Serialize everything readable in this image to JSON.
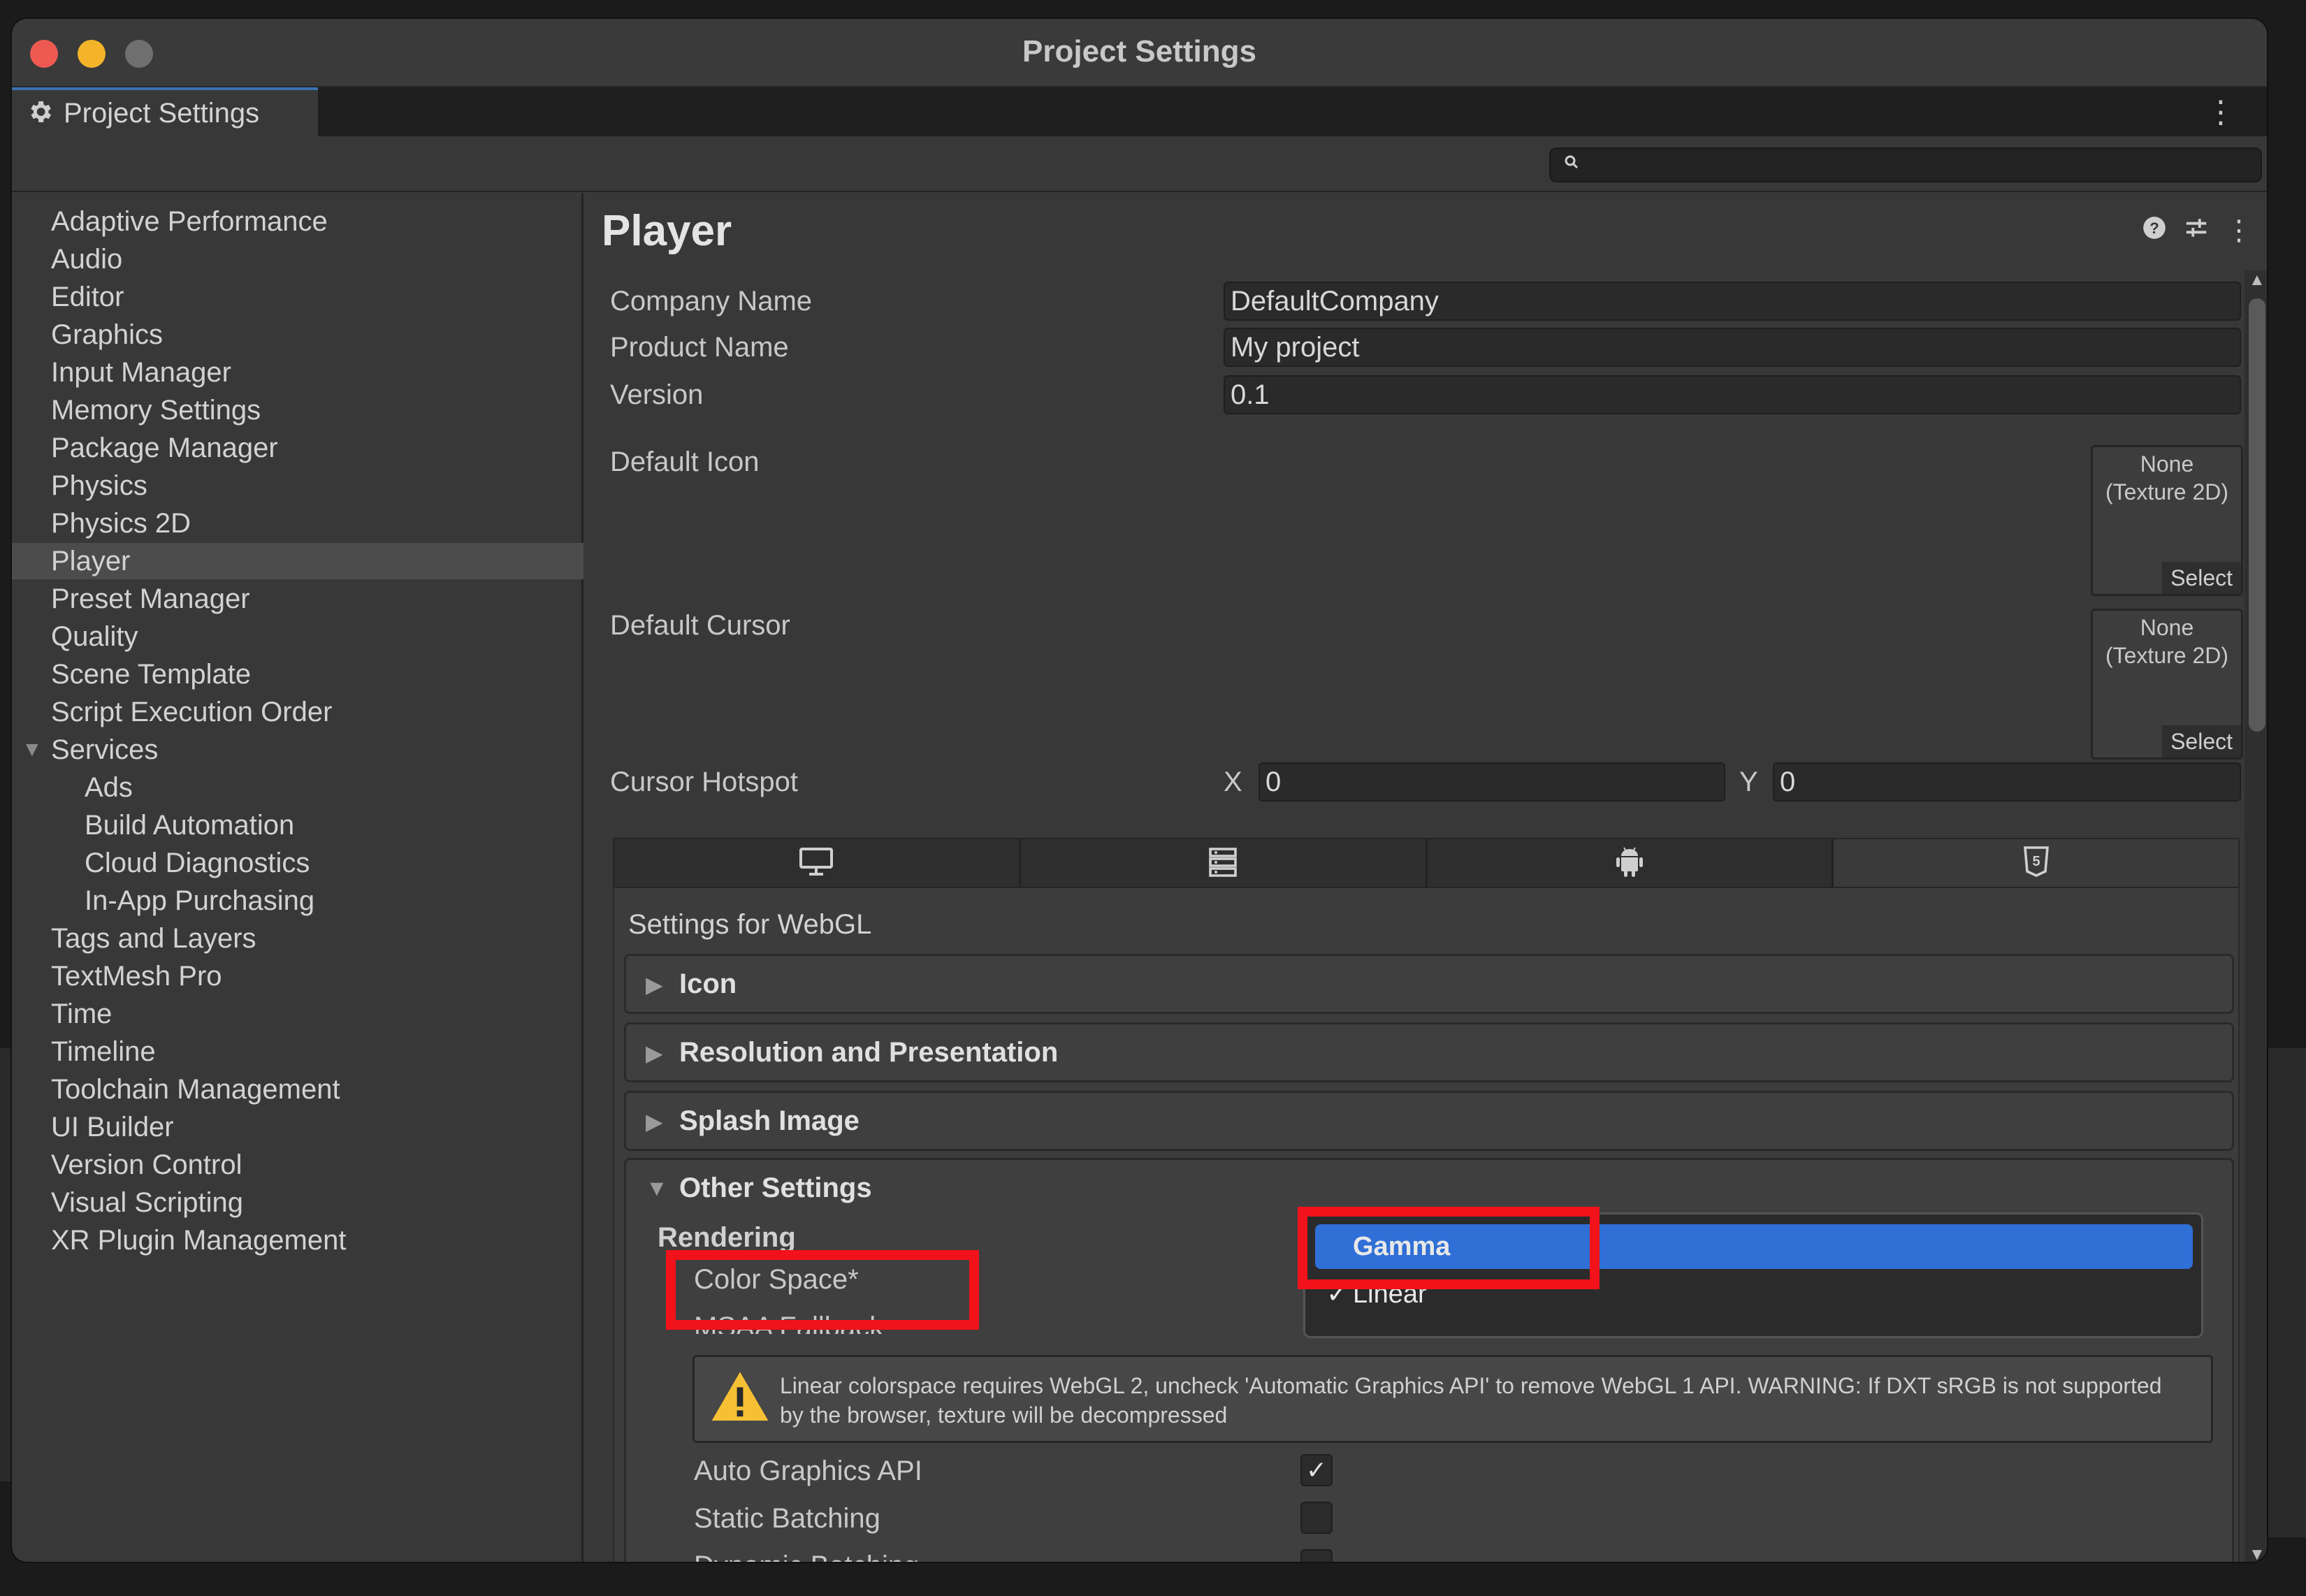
{
  "window": {
    "title": "Project Settings"
  },
  "tab": {
    "label": "Project Settings"
  },
  "search": {
    "placeholder": ""
  },
  "sidebar": {
    "items": [
      {
        "label": "Adaptive Performance"
      },
      {
        "label": "Audio"
      },
      {
        "label": "Editor"
      },
      {
        "label": "Graphics"
      },
      {
        "label": "Input Manager"
      },
      {
        "label": "Memory Settings"
      },
      {
        "label": "Package Manager"
      },
      {
        "label": "Physics"
      },
      {
        "label": "Physics 2D"
      },
      {
        "label": "Player",
        "selected": true
      },
      {
        "label": "Preset Manager"
      },
      {
        "label": "Quality"
      },
      {
        "label": "Scene Template"
      },
      {
        "label": "Script Execution Order"
      },
      {
        "label": "Services",
        "expanded": true
      },
      {
        "label": "Ads",
        "child": true
      },
      {
        "label": "Build Automation",
        "child": true
      },
      {
        "label": "Cloud Diagnostics",
        "child": true
      },
      {
        "label": "In-App Purchasing",
        "child": true
      },
      {
        "label": "Tags and Layers"
      },
      {
        "label": "TextMesh Pro"
      },
      {
        "label": "Time"
      },
      {
        "label": "Timeline"
      },
      {
        "label": "Toolchain Management"
      },
      {
        "label": "UI Builder"
      },
      {
        "label": "Version Control"
      },
      {
        "label": "Visual Scripting"
      },
      {
        "label": "XR Plugin Management"
      }
    ]
  },
  "player": {
    "title": "Player",
    "company_name_label": "Company Name",
    "company_name": "DefaultCompany",
    "product_name_label": "Product Name",
    "product_name": "My project",
    "version_label": "Version",
    "version": "0.1",
    "default_icon_label": "Default Icon",
    "default_cursor_label": "Default Cursor",
    "texture_none": "None",
    "texture_type": "(Texture 2D)",
    "select_label": "Select",
    "cursor_hotspot_label": "Cursor Hotspot",
    "hotspot_x_label": "X",
    "hotspot_x": "0",
    "hotspot_y_label": "Y",
    "hotspot_y": "0"
  },
  "platform_tabs": [
    "desktop-icon",
    "server-icon",
    "android-icon",
    "html5-icon"
  ],
  "settings_for": "Settings for WebGL",
  "foldouts": [
    {
      "label": "Icon"
    },
    {
      "label": "Resolution and Presentation"
    },
    {
      "label": "Splash Image"
    },
    {
      "label": "Other Settings"
    }
  ],
  "other_settings": {
    "rendering_label": "Rendering",
    "color_space_label": "Color Space*",
    "msaa_label": "MSAA Fallback",
    "warning_text": "Linear colorspace requires WebGL 2, uncheck 'Automatic Graphics API' to remove WebGL 1 API. WARNING: If DXT sRGB is not supported by the browser, texture will be decompressed",
    "auto_graphics_api_label": "Auto Graphics API",
    "auto_graphics_api_checked": true,
    "static_batching_label": "Static Batching",
    "static_batching_checked": false,
    "dynamic_batching_label": "Dynamic Batching",
    "dynamic_batching_checked": false
  },
  "color_space_dropdown": {
    "options": [
      {
        "label": "Gamma",
        "highlighted": true,
        "checked": false
      },
      {
        "label": "Linear",
        "highlighted": false,
        "checked": true
      }
    ]
  },
  "colors": {
    "accent_highlight": "#2f6fd6",
    "annotation_red": "#f1121a",
    "tab_accent": "#3a72b0"
  }
}
